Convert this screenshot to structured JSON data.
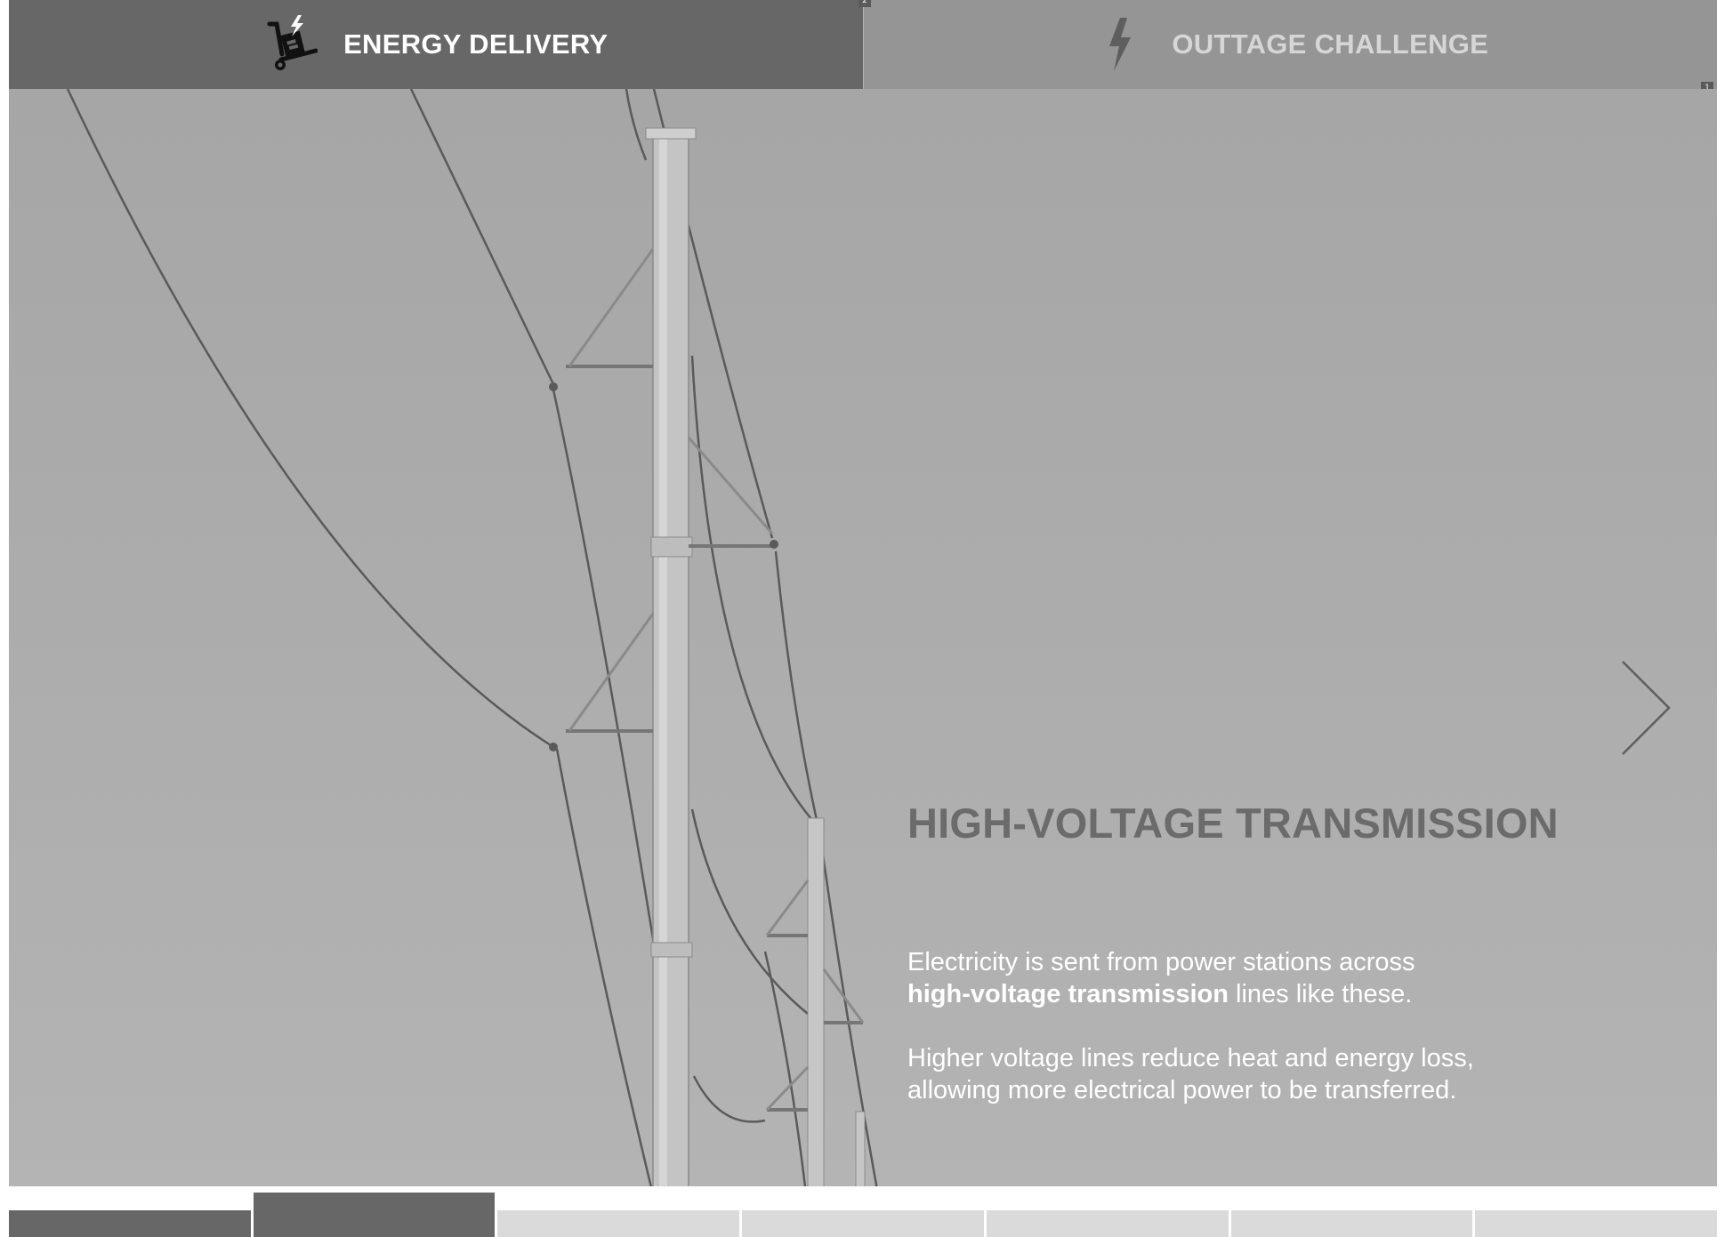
{
  "tabs": [
    {
      "label": "ENERGY DELIVERY",
      "icon": "hand-truck-lightning-icon",
      "active": true
    },
    {
      "label": "OUTTAGE CHALLENGE",
      "icon": "lightning-bolt-icon",
      "active": false
    }
  ],
  "page_badges": {
    "top": "2",
    "side": "1"
  },
  "slide": {
    "title": "HIGH-VOLTAGE TRANSMISSION",
    "p1_a": "Electricity is sent from power stations across",
    "p1_bold": "high-voltage transmission",
    "p1_b": " lines like these.",
    "p2": "Higher voltage lines reduce heat and energy loss, allowing more electrical power to be transferred."
  },
  "navigation": {
    "next_icon": "chevron-right-icon"
  },
  "progress": {
    "total_segments": 7,
    "current_segment": 2
  },
  "colors": {
    "active_tab": "#676767",
    "inactive_tab": "#959595",
    "title": "#6b6b6b",
    "body_text": "#ffffff",
    "progress_active": "#676767",
    "progress_inactive": "#dadada"
  }
}
